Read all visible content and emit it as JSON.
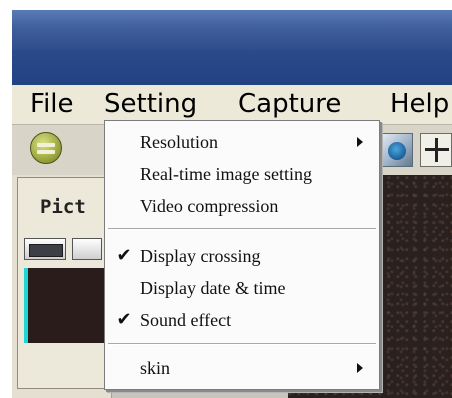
{
  "menubar": {
    "items": [
      {
        "label": "File"
      },
      {
        "label": "Setting"
      },
      {
        "label": "Capture"
      },
      {
        "label": "Help"
      }
    ]
  },
  "panel": {
    "title": "Pict"
  },
  "setting_menu": {
    "items": [
      {
        "label": "Resolution",
        "checked": false,
        "submenu": true
      },
      {
        "label": "Real-time image setting",
        "checked": false,
        "submenu": false
      },
      {
        "label": "Video compression",
        "checked": false,
        "submenu": false
      },
      {
        "label": "Display crossing",
        "checked": true,
        "submenu": false
      },
      {
        "label": "Display date & time",
        "checked": false,
        "submenu": false
      },
      {
        "label": "Sound effect",
        "checked": true,
        "submenu": false
      },
      {
        "label": "skin",
        "checked": false,
        "submenu": true
      }
    ],
    "check_glyph": "✔"
  },
  "icons": {
    "toolbar_left": "minus-circle-icon",
    "toolbar_camera": "camera-icon",
    "toolbar_plus": "plus-icon",
    "submenu_arrow": "triangle-right-icon",
    "checkmark": "check-icon"
  },
  "colors": {
    "titlebar": "#2f4d8a",
    "menubar": "#ece9d8",
    "menu_bg": "#fbfbfb",
    "preview_accent": "#1fd6d6"
  }
}
